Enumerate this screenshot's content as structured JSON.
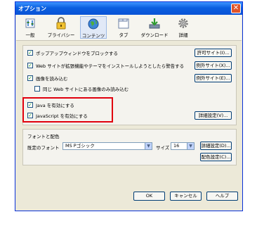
{
  "dialog": {
    "title": "オプション",
    "close_label": "✕"
  },
  "toolbar": {
    "tabs": [
      {
        "label": "一般",
        "icon": "general-icon"
      },
      {
        "label": "プライバシー",
        "icon": "lock-icon"
      },
      {
        "label": "コンテンツ",
        "icon": "globe-icon"
      },
      {
        "label": "タブ",
        "icon": "tabs-icon"
      },
      {
        "label": "ダウンロード",
        "icon": "download-icon"
      },
      {
        "label": "詳細",
        "icon": "gear-icon"
      }
    ],
    "active_tab": "コンテンツ"
  },
  "content": {
    "options": [
      {
        "label": "ポップアップウィンドウをブロックする",
        "checked": true,
        "button": "許可サイト(I)..."
      },
      {
        "label": "Web サイトが拡張機能やテーマをインストールしようとしたら警告する",
        "checked": true,
        "button": "例外サイト(X)..."
      },
      {
        "label": "画像を読み込む",
        "checked": true,
        "button": "例外サイト(E)..."
      },
      {
        "label": "同じ Web サイトにある画像のみ読み込む",
        "checked": false
      },
      {
        "label": "Java を有効にする",
        "checked": true
      },
      {
        "label": "JavaScript を有効にする",
        "checked": true,
        "button": "詳細設定(V)..."
      }
    ]
  },
  "fonts": {
    "group_title": "フォントと配色",
    "default_font_label": "既定のフォント",
    "default_font_value": "MS Pゴシック",
    "size_label": "サイズ",
    "size_value": "16",
    "advanced_button": "詳細設定(D)...",
    "colors_button": "配色設定(C)..."
  },
  "footer": {
    "ok": "OK",
    "cancel": "キャンセル",
    "help": "ヘルプ"
  },
  "colors": {
    "title_bar": "#0a53d6",
    "highlight_box": "#e1000e",
    "dialog_bg": "#ece9d8"
  }
}
